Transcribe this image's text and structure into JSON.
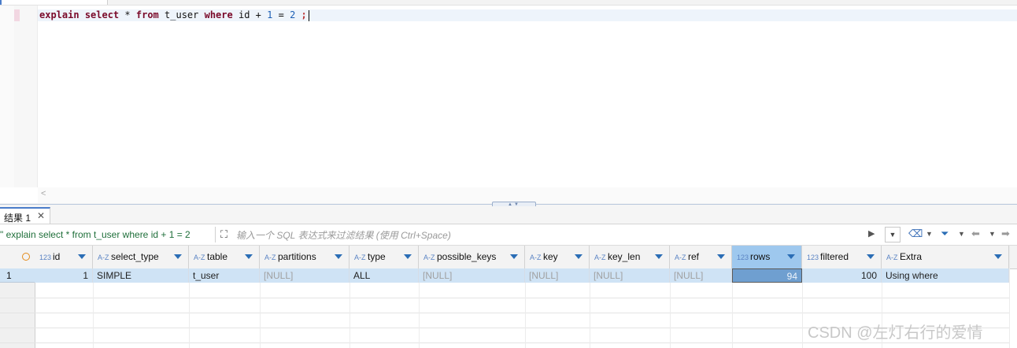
{
  "editor": {
    "sql_parts": [
      "explain",
      "select",
      "*",
      "from",
      "t_user",
      "where",
      "id",
      "+",
      "1",
      "=",
      "2",
      ";"
    ]
  },
  "results": {
    "tab_label": "结果 1",
    "tab_close": "✕",
    "filter_query": "explain select * from t_user where id + 1 = 2",
    "filter_placeholder": "输入一个 SQL 表达式来过滤结果 (使用 Ctrl+Space)",
    "columns": [
      {
        "type": "123",
        "name": "id"
      },
      {
        "type": "A-Z",
        "name": "select_type"
      },
      {
        "type": "A-Z",
        "name": "table"
      },
      {
        "type": "A-Z",
        "name": "partitions"
      },
      {
        "type": "A-Z",
        "name": "type"
      },
      {
        "type": "A-Z",
        "name": "possible_keys"
      },
      {
        "type": "A-Z",
        "name": "key"
      },
      {
        "type": "A-Z",
        "name": "key_len"
      },
      {
        "type": "A-Z",
        "name": "ref"
      },
      {
        "type": "123",
        "name": "rows"
      },
      {
        "type": "123",
        "name": "filtered"
      },
      {
        "type": "A-Z",
        "name": "Extra"
      }
    ],
    "rows": [
      {
        "num": "1",
        "cells": [
          "1",
          "SIMPLE",
          "t_user",
          "[NULL]",
          "ALL",
          "[NULL]",
          "[NULL]",
          "[NULL]",
          "[NULL]",
          "94",
          "100",
          "Using where"
        ]
      }
    ]
  },
  "watermark": "CSDN @左灯右行的爱情"
}
